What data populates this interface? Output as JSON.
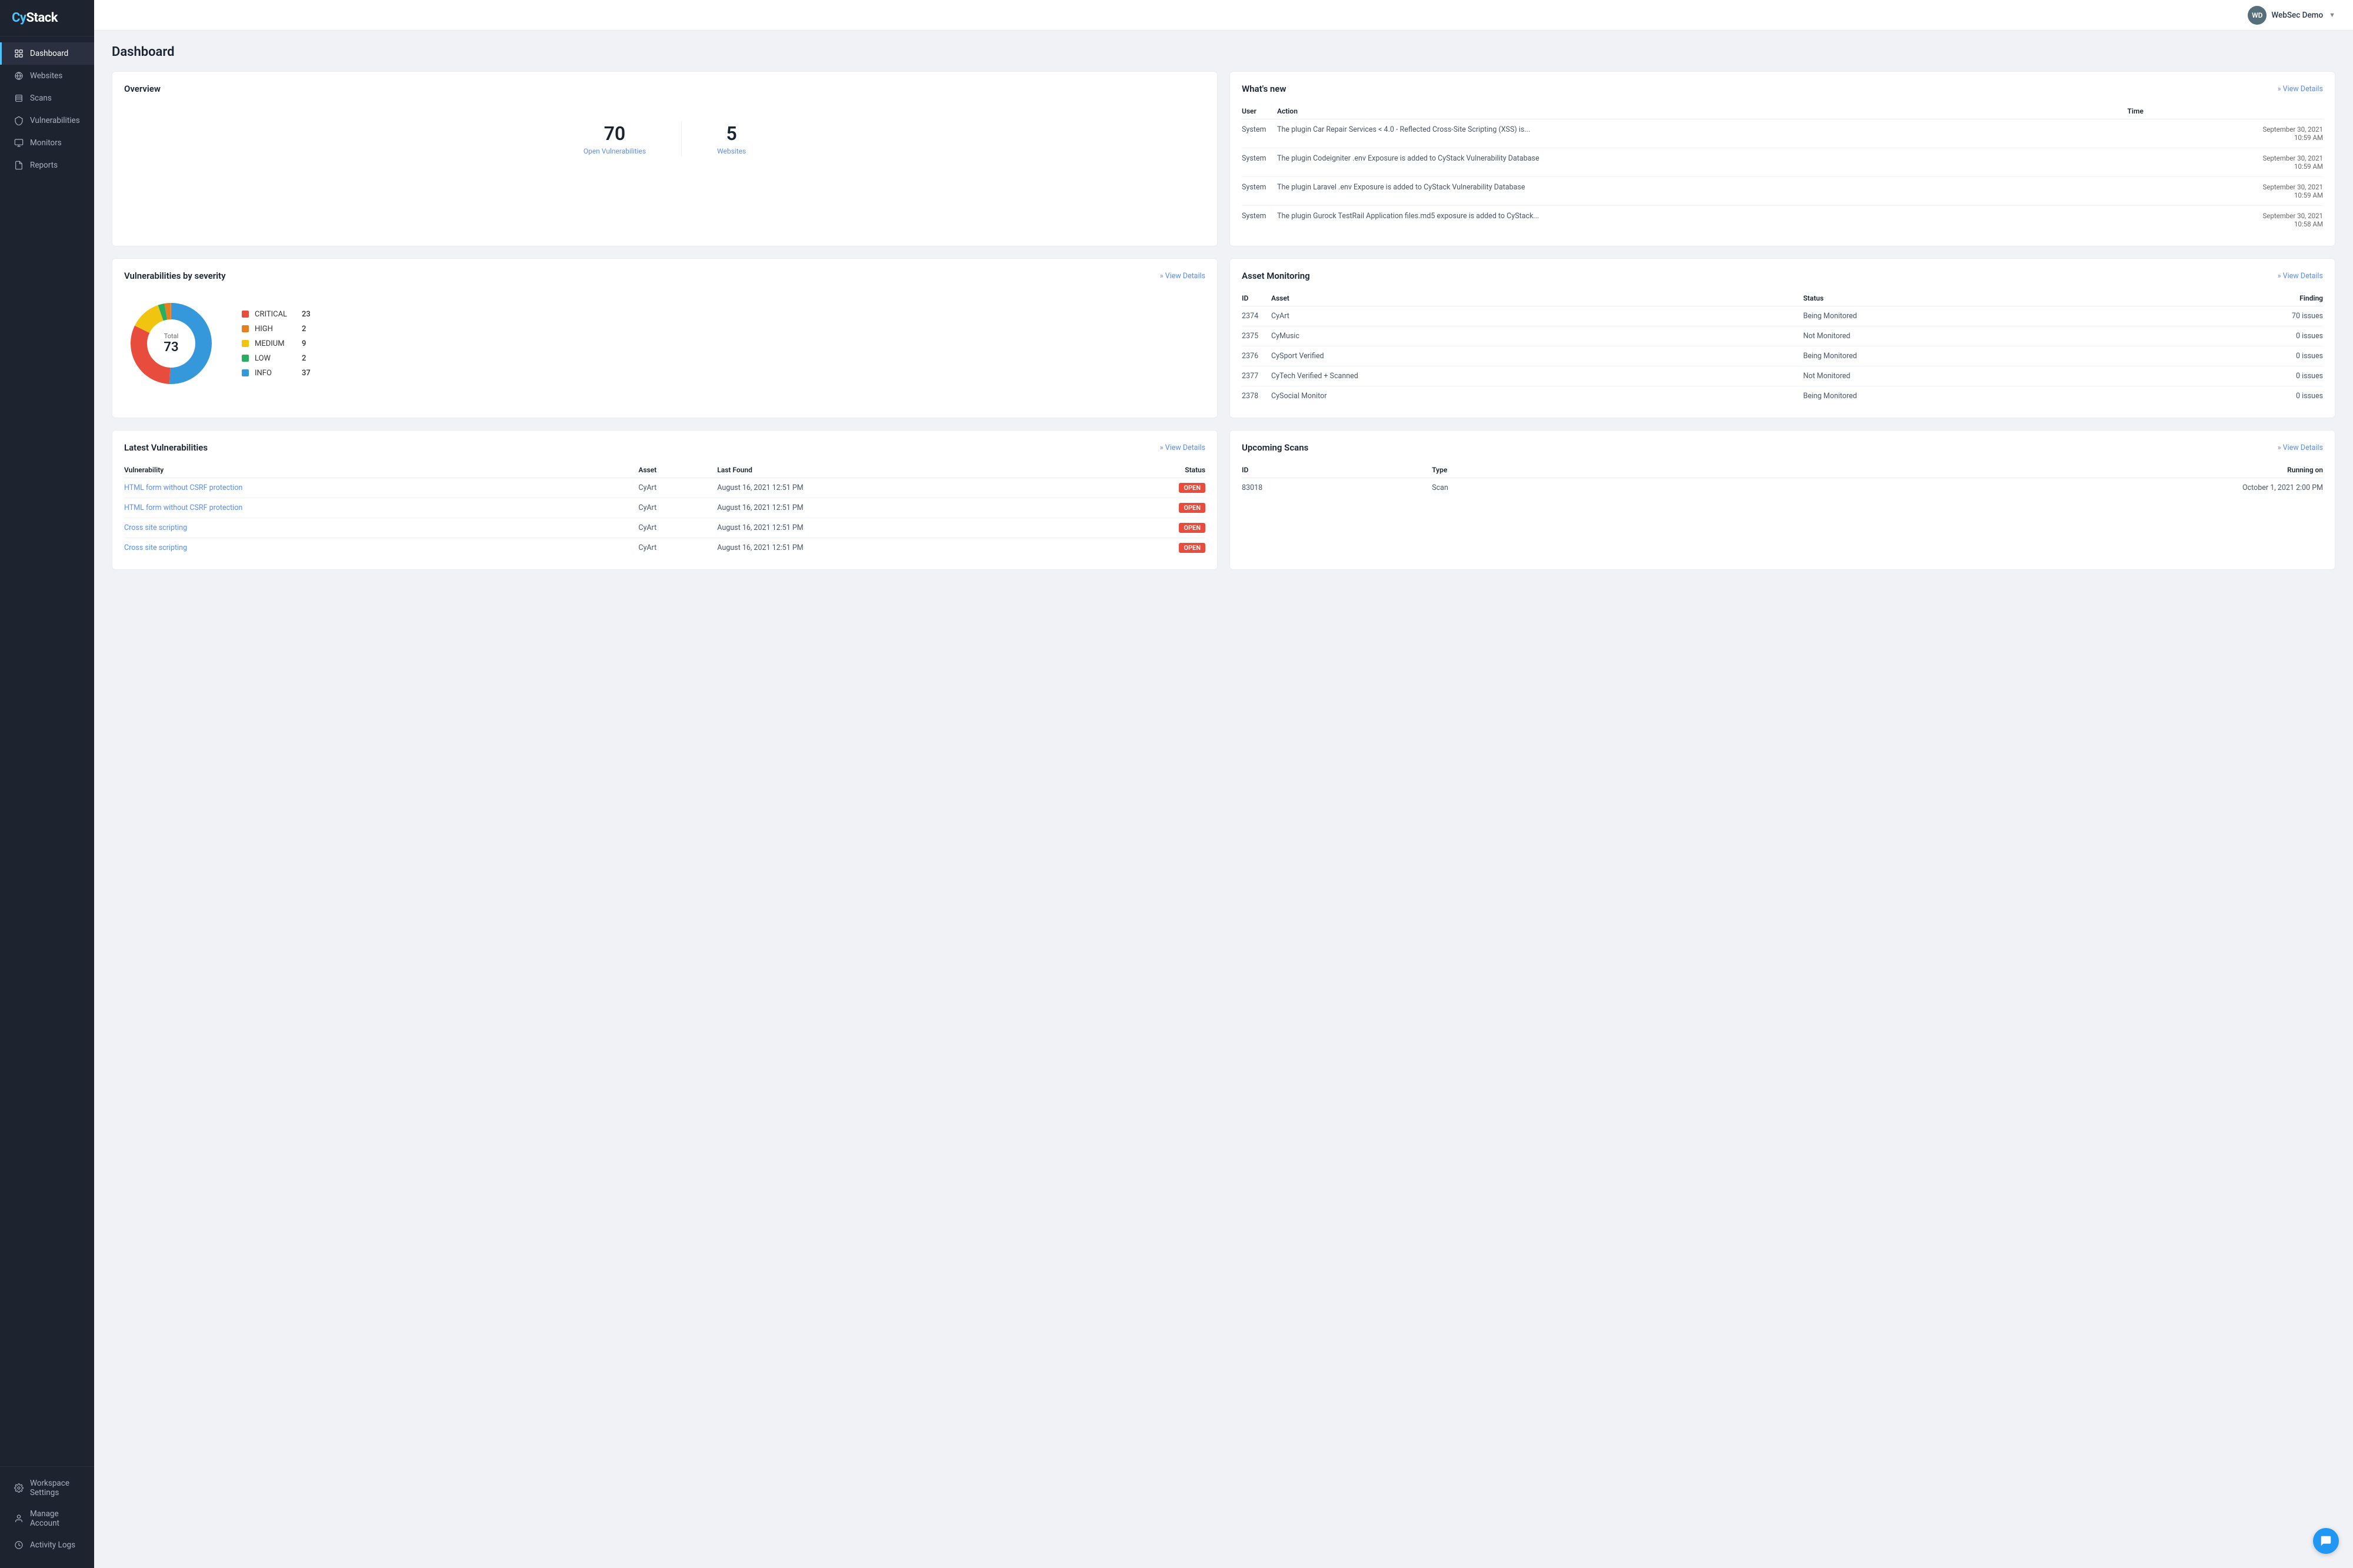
{
  "app": {
    "name": "CyStack",
    "name_cy": "Cy",
    "name_stack": "Stack"
  },
  "user": {
    "initials": "WD",
    "name": "WebSec Demo",
    "avatar_bg": "#546e7a"
  },
  "sidebar": {
    "items": [
      {
        "id": "dashboard",
        "label": "Dashboard",
        "icon": "dashboard",
        "active": true
      },
      {
        "id": "websites",
        "label": "Websites",
        "icon": "websites",
        "active": false
      },
      {
        "id": "scans",
        "label": "Scans",
        "icon": "scans",
        "active": false
      },
      {
        "id": "vulnerabilities",
        "label": "Vulnerabilities",
        "icon": "vulnerabilities",
        "active": false
      },
      {
        "id": "monitors",
        "label": "Monitors",
        "icon": "monitors",
        "active": false
      },
      {
        "id": "reports",
        "label": "Reports",
        "icon": "reports",
        "active": false
      }
    ],
    "bottom_items": [
      {
        "id": "workspace-settings",
        "label": "Workspace Settings",
        "icon": "settings"
      },
      {
        "id": "manage-account",
        "label": "Manage Account",
        "icon": "account"
      },
      {
        "id": "activity-logs",
        "label": "Activity Logs",
        "icon": "clock"
      }
    ]
  },
  "page": {
    "title": "Dashboard"
  },
  "overview": {
    "title": "Overview",
    "open_vulnerabilities_count": "70",
    "open_vulnerabilities_label": "Open Vulnerabilities",
    "websites_count": "5",
    "websites_label": "Websites"
  },
  "whats_new": {
    "title": "What's new",
    "view_details": "» View Details",
    "columns": [
      "User",
      "Action",
      "Time"
    ],
    "rows": [
      {
        "user": "System",
        "action": "The plugin Car Repair Services < 4.0 - Reflected Cross-Site Scripting (XSS) is...",
        "time": "September 30, 2021",
        "time2": "10:59 AM"
      },
      {
        "user": "System",
        "action": "The plugin Codeigniter .env Exposure is added to CyStack Vulnerability Database",
        "time": "September 30, 2021",
        "time2": "10:59 AM"
      },
      {
        "user": "System",
        "action": "The plugin Laravel .env Exposure is added to CyStack Vulnerability Database",
        "time": "September 30, 2021",
        "time2": "10:59 AM"
      },
      {
        "user": "System",
        "action": "The plugin Gurock TestRail Application files.md5 exposure is added to CyStack...",
        "time": "September 30, 2021",
        "time2": "10:58 AM"
      }
    ]
  },
  "vuln_severity": {
    "title": "Vulnerabilities by severity",
    "view_details": "» View Details",
    "total_label": "Total",
    "total": "73",
    "legend": [
      {
        "name": "CRITICAL",
        "value": "23",
        "color": "#e74c3c"
      },
      {
        "name": "HIGH",
        "value": "2",
        "color": "#e67e22"
      },
      {
        "name": "MEDIUM",
        "value": "9",
        "color": "#f1c40f"
      },
      {
        "name": "LOW",
        "value": "2",
        "color": "#27ae60"
      },
      {
        "name": "INFO",
        "value": "37",
        "color": "#3498db"
      }
    ],
    "donut": {
      "segments": [
        {
          "name": "CRITICAL",
          "value": 23,
          "color": "#e74c3c"
        },
        {
          "name": "HIGH",
          "value": 2,
          "color": "#e67e22"
        },
        {
          "name": "MEDIUM",
          "value": 9,
          "color": "#f1c40f"
        },
        {
          "name": "LOW",
          "value": 2,
          "color": "#27ae60"
        },
        {
          "name": "INFO",
          "value": 37,
          "color": "#3498db"
        }
      ]
    }
  },
  "asset_monitoring": {
    "title": "Asset Monitoring",
    "view_details": "» View Details",
    "columns": [
      "ID",
      "Asset",
      "Status",
      "Finding"
    ],
    "rows": [
      {
        "id": "2374",
        "asset": "CyArt",
        "status": "Being Monitored",
        "finding": "70 issues",
        "status_type": "being"
      },
      {
        "id": "2375",
        "asset": "CyMusic",
        "status": "Not Monitored",
        "finding": "0 issues",
        "status_type": "not"
      },
      {
        "id": "2376",
        "asset": "CySport Verified",
        "status": "Being Monitored",
        "finding": "0 issues",
        "status_type": "being"
      },
      {
        "id": "2377",
        "asset": "CyTech Verified + Scanned",
        "status": "Not Monitored",
        "finding": "0 issues",
        "status_type": "not"
      },
      {
        "id": "2378",
        "asset": "CySocial Monitor",
        "status": "Being Monitored",
        "finding": "0 issues",
        "status_type": "being"
      }
    ]
  },
  "latest_vulnerabilities": {
    "title": "Latest Vulnerabilities",
    "view_details": "» View Details",
    "columns": [
      "Vulnerability",
      "Asset",
      "Last Found",
      "Status"
    ],
    "rows": [
      {
        "vuln": "HTML form without CSRF protection",
        "asset": "CyArt",
        "last_found": "August 16, 2021 12:51 PM",
        "status": "OPEN"
      },
      {
        "vuln": "HTML form without CSRF protection",
        "asset": "CyArt",
        "last_found": "August 16, 2021 12:51 PM",
        "status": "OPEN"
      },
      {
        "vuln": "Cross site scripting",
        "asset": "CyArt",
        "last_found": "August 16, 2021 12:51 PM",
        "status": "OPEN"
      },
      {
        "vuln": "Cross site scripting",
        "asset": "CyArt",
        "last_found": "August 16, 2021 12:51 PM",
        "status": "OPEN"
      }
    ]
  },
  "upcoming_scans": {
    "title": "Upcoming Scans",
    "view_details": "» View Details",
    "columns": [
      "ID",
      "Type",
      "Running on"
    ],
    "rows": [
      {
        "id": "83018",
        "type": "Scan",
        "running_on": "October 1, 2021 2:00 PM"
      }
    ]
  }
}
